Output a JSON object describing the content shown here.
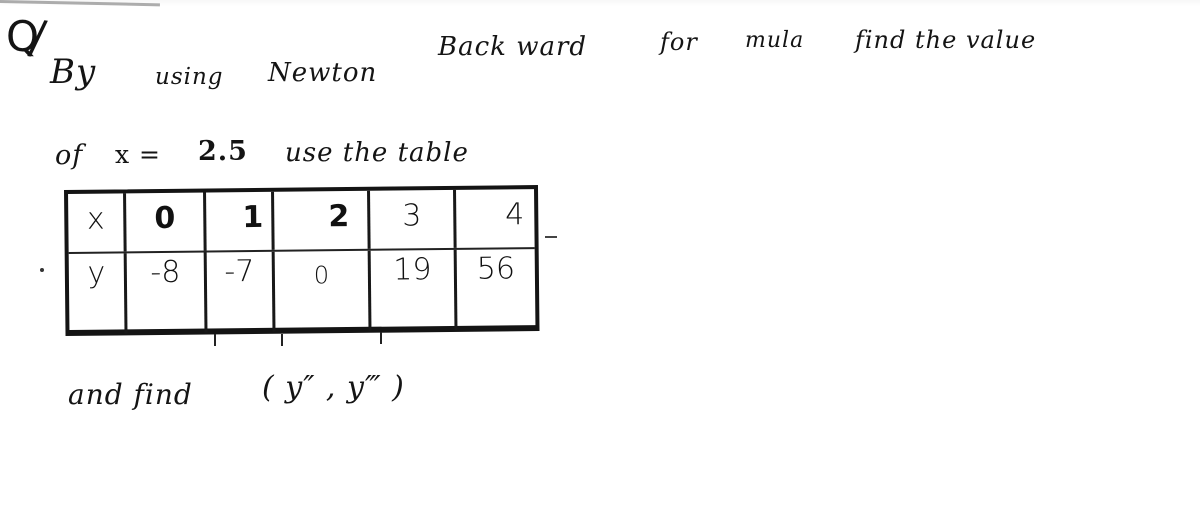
{
  "question": {
    "label": "Q",
    "label_slash": "/",
    "line1": {
      "by": "By",
      "using": "using",
      "newton": "Newton",
      "backward": "Back ward",
      "for": "for",
      "mula": "mula",
      "find_the_value": "find the value"
    },
    "line2": {
      "of": "of",
      "x_eq": "x =",
      "x_value": "2.5",
      "use_the_table": "use the table"
    },
    "table": {
      "x_label": "x",
      "y_label": "y",
      "x_values": [
        "0",
        "1",
        "2",
        "3",
        "4"
      ],
      "y_values": [
        "-8",
        "-7",
        "0",
        "19",
        "56"
      ]
    },
    "line4": {
      "and_find": "and find",
      "derivatives": "( y″ ,  y‴ )"
    }
  }
}
